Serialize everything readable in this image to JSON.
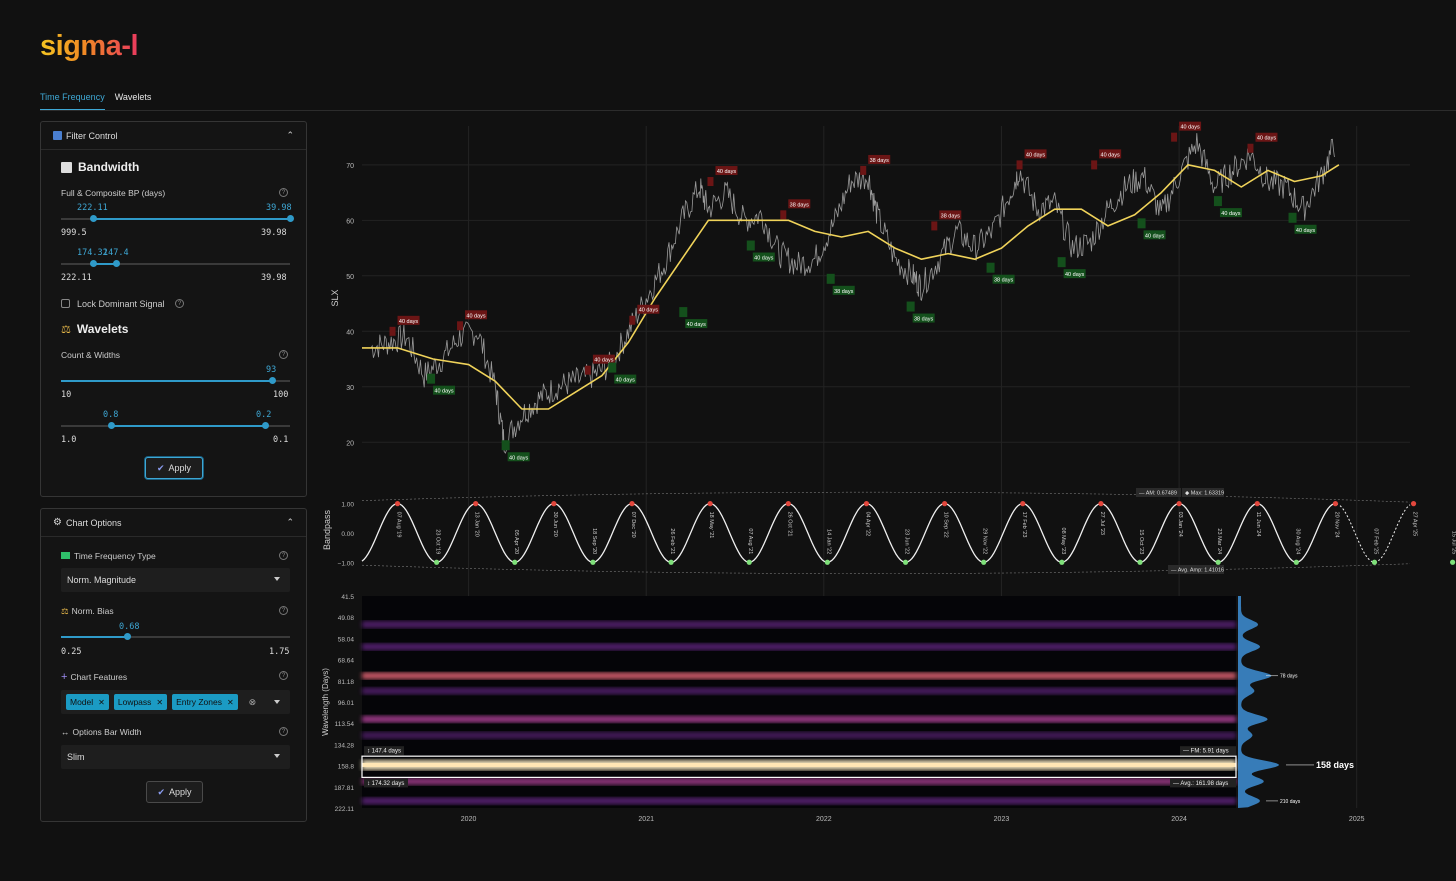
{
  "app": {
    "logo": "sigma-l"
  },
  "tabs": [
    {
      "label": "Time Frequency"
    },
    {
      "label": "Wavelets"
    }
  ],
  "filter_control": {
    "title": "Filter Control",
    "bandwidth": {
      "title": "Bandwidth",
      "label": "Full & Composite BP (days)",
      "slider1": {
        "low_value": "222.11",
        "high_value": "39.98",
        "min": "999.5",
        "max": "39.98",
        "low_pos": 0.14,
        "high_pos": 1.0
      },
      "slider2": {
        "low_value": "174.32",
        "high_value": "147.4",
        "min": "222.11",
        "max": "39.98",
        "low_pos": 0.14,
        "high_pos": 0.24
      }
    },
    "lock": {
      "label": "Lock Dominant Signal",
      "checked": false
    },
    "wavelets": {
      "title": "Wavelets",
      "label": "Count & Widths",
      "slider1": {
        "value": "93",
        "min": "10",
        "max": "100",
        "pos": 0.92
      },
      "slider2": {
        "low_value": "0.8",
        "high_value": "0.2",
        "min": "1.0",
        "max": "0.1",
        "low_pos": 0.22,
        "high_pos": 0.89
      }
    },
    "apply_label": "Apply"
  },
  "chart_options": {
    "title": "Chart Options",
    "tf_type": {
      "label": "Time Frequency Type",
      "value": "Norm. Magnitude"
    },
    "norm_bias": {
      "label": "Norm. Bias",
      "value": "0.68",
      "min": "0.25",
      "max": "1.75",
      "pos": 0.29
    },
    "features": {
      "label": "Chart Features",
      "tags": [
        "Model",
        "Lowpass",
        "Entry Zones"
      ]
    },
    "bar_width": {
      "label": "Options Bar Width",
      "value": "Slim"
    },
    "apply_label": "Apply"
  },
  "colors": {
    "accent": "#3ea7d4",
    "price_line": "#9a9a9a",
    "lowpass_line": "#f0d35a",
    "peak_marker": "#e2473d",
    "trough_marker": "#7fe07a",
    "peak_label_bg": "#6b1515",
    "trough_label_bg": "#14501c"
  },
  "chart_data": [
    {
      "type": "line",
      "ylabel": "SLX",
      "yticks": [
        20,
        30,
        40,
        50,
        60,
        70
      ],
      "ylim": [
        15,
        77
      ],
      "x_years": [
        "2020",
        "2021",
        "2022",
        "2023",
        "2024",
        "2025"
      ],
      "xlim": [
        2019.4,
        2025.3
      ],
      "series": [
        {
          "name": "",
          "x": [
            2019.45,
            2019.55,
            2019.65,
            2019.75,
            2019.85,
            2019.95,
            2020.05,
            2020.15,
            2020.2,
            2020.3,
            2020.4,
            2020.5,
            2020.6,
            2020.7,
            2020.8,
            2020.9,
            2021.0,
            2021.1,
            2021.2,
            2021.3,
            2021.35,
            2021.45,
            2021.55,
            2021.65,
            2021.75,
            2021.85,
            2021.95,
            2022.05,
            2022.15,
            2022.25,
            2022.3,
            2022.4,
            2022.5,
            2022.55,
            2022.65,
            2022.75,
            2022.85,
            2022.95,
            2023.05,
            2023.1,
            2023.2,
            2023.3,
            2023.4,
            2023.5,
            2023.6,
            2023.7,
            2023.8,
            2023.9,
            2024.0,
            2024.1,
            2024.2,
            2024.3,
            2024.4,
            2024.5,
            2024.6,
            2024.7,
            2024.8,
            2024.88
          ],
          "values": [
            37,
            38,
            39,
            32,
            35,
            39,
            40,
            30,
            20,
            25,
            28,
            30,
            31,
            32,
            34,
            40,
            46,
            52,
            60,
            66,
            62,
            65,
            60,
            61,
            54,
            52,
            53,
            59,
            67,
            68,
            61,
            53,
            50,
            48,
            53,
            58,
            55,
            58,
            65,
            69,
            62,
            63,
            55,
            56,
            62,
            66,
            68,
            61,
            68,
            74,
            66,
            69,
            72,
            67,
            66,
            62,
            68,
            74
          ]
        },
        {
          "name": "",
          "x": [
            2019.4,
            2019.6,
            2019.8,
            2020.0,
            2020.15,
            2020.3,
            2020.45,
            2020.6,
            2020.75,
            2020.9,
            2021.05,
            2021.2,
            2021.35,
            2021.5,
            2021.65,
            2021.8,
            2021.95,
            2022.1,
            2022.25,
            2022.4,
            2022.55,
            2022.7,
            2022.85,
            2023.0,
            2023.15,
            2023.3,
            2023.45,
            2023.6,
            2023.75,
            2023.9,
            2024.05,
            2024.2,
            2024.35,
            2024.5,
            2024.65,
            2024.8,
            2024.9
          ],
          "values": [
            37,
            37,
            35,
            34,
            31,
            26,
            26,
            29,
            32,
            38,
            46,
            53,
            60,
            60,
            60,
            60,
            58,
            57,
            58,
            55,
            53,
            54,
            53,
            55,
            59,
            62,
            62,
            59,
            61,
            65,
            70,
            69,
            66,
            69,
            67,
            68,
            70
          ]
        }
      ],
      "annotations": {
        "peaks": [
          {
            "x": 2019.6,
            "y": 39,
            "label": "40 days"
          },
          {
            "x": 2019.98,
            "y": 40,
            "label": "40 days"
          },
          {
            "x": 2020.7,
            "y": 32,
            "label": "40 days"
          },
          {
            "x": 2020.95,
            "y": 41,
            "label": "40 days"
          },
          {
            "x": 2021.39,
            "y": 66,
            "label": "40 days"
          },
          {
            "x": 2021.8,
            "y": 60,
            "label": "38 days"
          },
          {
            "x": 2022.25,
            "y": 68,
            "label": "38 days"
          },
          {
            "x": 2022.65,
            "y": 58,
            "label": "38 days"
          },
          {
            "x": 2023.13,
            "y": 69,
            "label": "40 days"
          },
          {
            "x": 2023.55,
            "y": 69,
            "label": "40 days"
          },
          {
            "x": 2024.0,
            "y": 74,
            "label": "40 days"
          },
          {
            "x": 2024.43,
            "y": 72,
            "label": "40 days"
          }
        ],
        "troughs": [
          {
            "x": 2019.8,
            "y": 32,
            "label": "40 days"
          },
          {
            "x": 2020.22,
            "y": 20,
            "label": "40 days"
          },
          {
            "x": 2020.82,
            "y": 34,
            "label": "40 days"
          },
          {
            "x": 2021.22,
            "y": 44,
            "label": "40 days"
          },
          {
            "x": 2021.6,
            "y": 56,
            "label": "40 days"
          },
          {
            "x": 2022.05,
            "y": 50,
            "label": "38 days"
          },
          {
            "x": 2022.5,
            "y": 45,
            "label": "38 days"
          },
          {
            "x": 2022.95,
            "y": 52,
            "label": "38 days"
          },
          {
            "x": 2023.35,
            "y": 53,
            "label": "40 days"
          },
          {
            "x": 2023.8,
            "y": 60,
            "label": "40 days"
          },
          {
            "x": 2024.23,
            "y": 64,
            "label": "40 days"
          },
          {
            "x": 2024.65,
            "y": 61,
            "label": "40 days"
          }
        ]
      }
    },
    {
      "type": "line",
      "ylabel": "Bandpass",
      "yticks": [
        "1.00",
        "0.00",
        "−1.00"
      ],
      "ylim": [
        -1.4,
        1.6
      ],
      "cycle_days": 158,
      "stats": {
        "am": "AM: 0.67489",
        "max": "Max: 1.63319",
        "avg_amp": "Avg. Amp: 1.41016"
      },
      "events": [
        {
          "type": "peak",
          "date": "07 Aug '19"
        },
        {
          "type": "trough",
          "date": "23 Oct '19"
        },
        {
          "type": "peak",
          "date": "13 Jan '20"
        },
        {
          "type": "trough",
          "date": "05 Apr '20"
        },
        {
          "type": "peak",
          "date": "30 Jun '20"
        },
        {
          "type": "trough",
          "date": "18 Sep '20"
        },
        {
          "type": "peak",
          "date": "07 Dec '20"
        },
        {
          "type": "trough",
          "date": "26 Feb '21"
        },
        {
          "type": "peak",
          "date": "18 May '21"
        },
        {
          "type": "trough",
          "date": "07 Aug '21"
        },
        {
          "type": "peak",
          "date": "26 Oct '21"
        },
        {
          "type": "trough",
          "date": "14 Jan '22"
        },
        {
          "type": "peak",
          "date": "04 Apr '22"
        },
        {
          "type": "trough",
          "date": "23 Jun '22"
        },
        {
          "type": "peak",
          "date": "10 Sep '22"
        },
        {
          "type": "trough",
          "date": "29 Nov '22"
        },
        {
          "type": "peak",
          "date": "17 Feb '23"
        },
        {
          "type": "trough",
          "date": "08 May '23"
        },
        {
          "type": "peak",
          "date": "27 Jul '23"
        },
        {
          "type": "trough",
          "date": "15 Oct '23"
        },
        {
          "type": "peak",
          "date": "03 Jan '24"
        },
        {
          "type": "trough",
          "date": "23 Mar '24"
        },
        {
          "type": "peak",
          "date": "11 Jun '24"
        },
        {
          "type": "trough",
          "date": "30 Aug '24"
        },
        {
          "type": "peak",
          "date": "20 Nov '24"
        },
        {
          "type": "trough",
          "date": "07 Feb '25"
        },
        {
          "type": "peak",
          "date": "27 Apr '25"
        },
        {
          "type": "trough",
          "date": "15 Jul '25"
        },
        {
          "type": "peak",
          "date": "02 Oct '25"
        }
      ]
    },
    {
      "type": "heatmap",
      "ylabel": "Wavelength (Days)",
      "yticks": [
        "41.5",
        "49.08",
        "58.04",
        "68.64",
        "81.18",
        "96.01",
        "113.54",
        "134.28",
        "158.8",
        "187.81",
        "222.11"
      ],
      "bands": [
        {
          "period": 52,
          "strength": 0.45
        },
        {
          "period": 62,
          "strength": 0.5
        },
        {
          "period": 78,
          "strength": 0.8
        },
        {
          "period": 88,
          "strength": 0.35
        },
        {
          "period": 110,
          "strength": 0.7
        },
        {
          "period": 125,
          "strength": 0.3
        },
        {
          "period": 158,
          "strength": 1.0
        },
        {
          "period": 180,
          "strength": 0.6
        },
        {
          "period": 210,
          "strength": 0.5
        }
      ],
      "selection": {
        "upper": "147.4 days",
        "lower": "174.32 days",
        "fm": "FM: 5.91 days",
        "avg": "Avg.: 161.98 days"
      },
      "spectrum_labels": [
        {
          "label": "78 days",
          "period": 78
        },
        {
          "label": "158 days",
          "period": 158
        },
        {
          "label": "210 days",
          "period": 210
        }
      ]
    }
  ]
}
